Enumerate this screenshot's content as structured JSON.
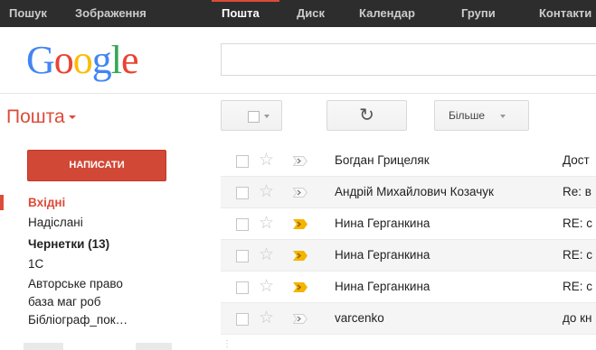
{
  "topnav": {
    "items": [
      {
        "label": "Пошук"
      },
      {
        "label": "Зображення"
      },
      {
        "label": "Пошта"
      },
      {
        "label": "Диск"
      },
      {
        "label": "Календар"
      },
      {
        "label": "Групи"
      },
      {
        "label": "Контакти"
      }
    ],
    "active_index": 2,
    "colors": {
      "bar_bg": "#2d2d2d",
      "active_accent": "#dd4b39"
    }
  },
  "logo": {
    "letters": [
      "G",
      "o",
      "o",
      "g",
      "l",
      "e"
    ],
    "colors": [
      "#4285f4",
      "#ea4335",
      "#fbbc05",
      "#4285f4",
      "#34a853",
      "#ea4335"
    ]
  },
  "search": {
    "value": "",
    "placeholder": ""
  },
  "app": {
    "title": "Пошта",
    "title_icon": "caret-down-icon",
    "accent": "#dd4b39"
  },
  "toolbar": {
    "select_icon": "checkbox-dropdown-icon",
    "refresh_icon": "refresh-icon",
    "refresh_glyph": "↻",
    "more_label": "Більше"
  },
  "compose": {
    "label": "НАПИСАТИ",
    "color": "#d14836"
  },
  "folders": [
    {
      "label": "Вхідні",
      "state": "selected"
    },
    {
      "label": "Надіслані",
      "state": "normal"
    },
    {
      "label": "Чернетки (13)",
      "state": "bold"
    },
    {
      "label": "1С",
      "state": "normal"
    },
    {
      "label": "Авторське право",
      "state": "normal"
    },
    {
      "label": "база маг роб",
      "state": "normal"
    },
    {
      "label": "Бібліограф_пок…",
      "state": "normal"
    }
  ],
  "emails": [
    {
      "sender": "Богдан Грицеляк",
      "subject": "Дост",
      "important": false,
      "starred": false
    },
    {
      "sender": "Андрій Михайлович Козачук",
      "subject": "Re: в",
      "important": false,
      "starred": false
    },
    {
      "sender": "Нина Герганкина",
      "subject": "RE: с",
      "important": true,
      "starred": false
    },
    {
      "sender": "Нина Герганкина",
      "subject": "RE: с",
      "important": true,
      "starred": false
    },
    {
      "sender": "Нина Герганкина",
      "subject": "RE: с",
      "important": true,
      "starred": false
    },
    {
      "sender": "varcenko",
      "subject": "до кн",
      "important": false,
      "starred": false
    }
  ]
}
